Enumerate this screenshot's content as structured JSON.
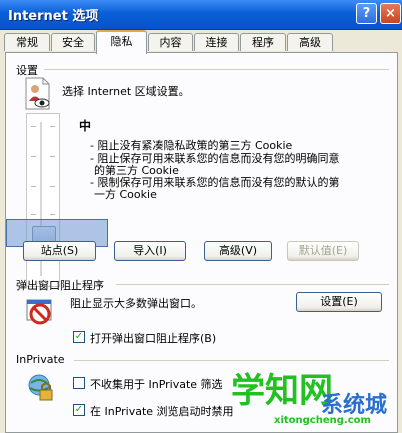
{
  "window": {
    "title": "Internet 选项",
    "help_glyph": "?",
    "close_glyph": "×"
  },
  "tabs": [
    {
      "label": "常规"
    },
    {
      "label": "安全"
    },
    {
      "label": "隐私",
      "active": true
    },
    {
      "label": "内容"
    },
    {
      "label": "连接"
    },
    {
      "label": "程序"
    },
    {
      "label": "高级"
    }
  ],
  "settings": {
    "section_label": "设置",
    "instruction": "选择 Internet 区域设置。",
    "level_label": "中",
    "slider_level": "中",
    "description_lines": [
      "- 阻止没有紧凑隐私政策的第三方 Cookie",
      "- 阻止保存可用来联系您的信息而没有您的明确同意",
      "的第三方 Cookie",
      "- 限制保存可用来联系您的信息而没有您的默认的第",
      "一方 Cookie"
    ],
    "buttons": {
      "sites": "站点(S)",
      "import": "导入(I)",
      "advanced": "高级(V)",
      "default": "默认值(E)"
    }
  },
  "popup_blocker": {
    "section_label": "弹出窗口阻止程序",
    "description": "阻止显示大多数弹出窗口。",
    "settings_button": "设置(E)",
    "enable_checkbox_label": "打开弹出窗口阻止程序(B)",
    "enable_checked": true
  },
  "inprivate": {
    "section_label": "InPrivate",
    "no_collect_label": "不收集用于 InPrivate 筛选",
    "no_collect_checked": false,
    "disable_label": "在 InPrivate 浏览启动时禁用",
    "disable_checked": true
  },
  "watermark": {
    "main": "学知网",
    "brand": "系统城",
    "domain": "xitongcheng.com"
  },
  "colors": {
    "title_blue": "#0a5fd8",
    "dialog_bg": "#ece9d8",
    "panel_bg": "#fcfcfe",
    "active_tab_highlight": "#e8a84a",
    "watermark_green": "#22c122"
  },
  "icons": [
    "privacy-document-eye-icon",
    "popup-blocked-icon",
    "inprivate-lock-globe-icon",
    "help-icon",
    "close-icon"
  ]
}
